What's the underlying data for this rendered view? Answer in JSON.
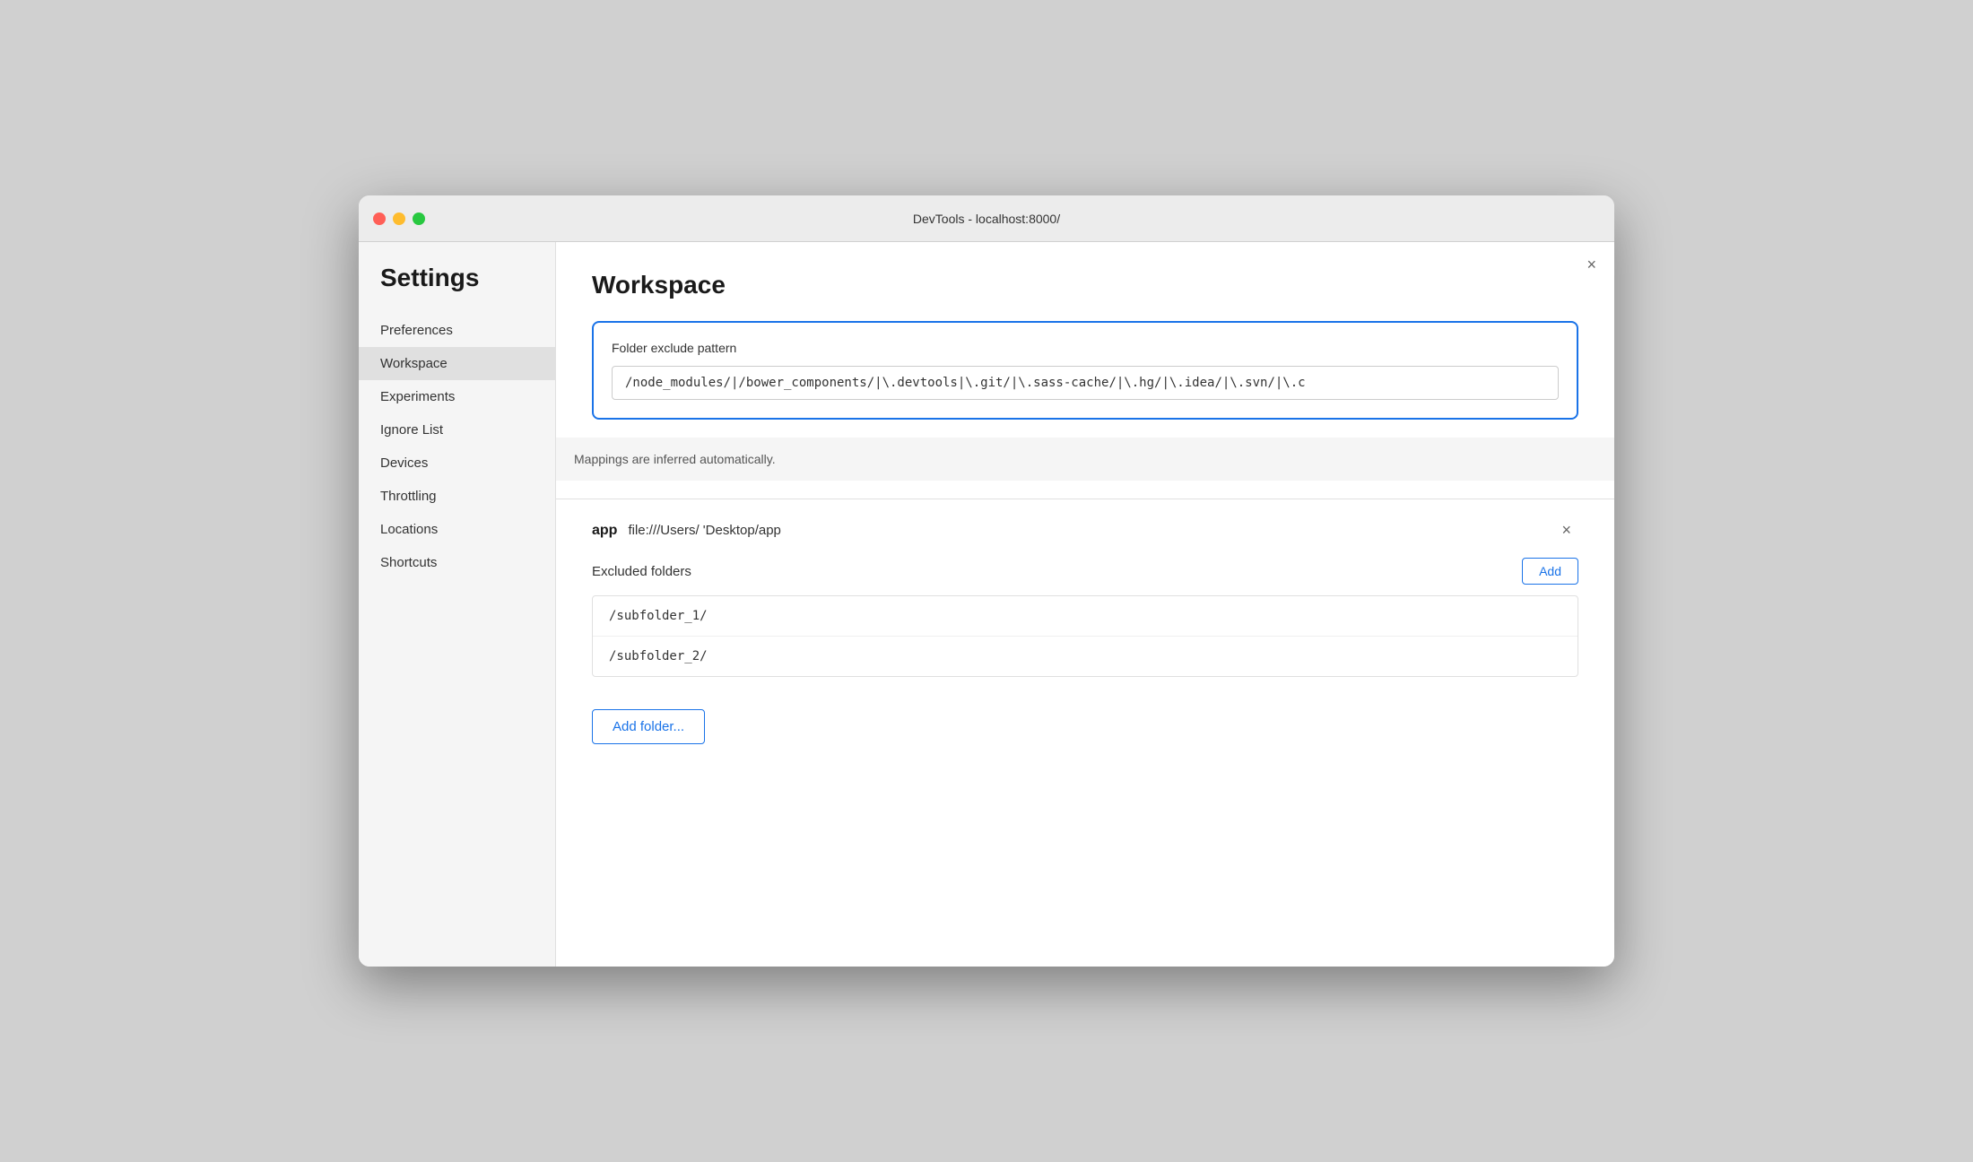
{
  "window": {
    "title": "DevTools - localhost:8000/"
  },
  "sidebar": {
    "heading": "Settings",
    "items": [
      {
        "id": "preferences",
        "label": "Preferences",
        "active": false
      },
      {
        "id": "workspace",
        "label": "Workspace",
        "active": true
      },
      {
        "id": "experiments",
        "label": "Experiments",
        "active": false
      },
      {
        "id": "ignore-list",
        "label": "Ignore List",
        "active": false
      },
      {
        "id": "devices",
        "label": "Devices",
        "active": false
      },
      {
        "id": "throttling",
        "label": "Throttling",
        "active": false
      },
      {
        "id": "locations",
        "label": "Locations",
        "active": false
      },
      {
        "id": "shortcuts",
        "label": "Shortcuts",
        "active": false
      }
    ]
  },
  "main": {
    "page_title": "Workspace",
    "close_button": "×",
    "folder_exclude": {
      "label": "Folder exclude pattern",
      "value": "/node_modules/|/bower_components/|\\.devtools|\\.git/|\\.sass-cache/|\\.hg/|\\.idea/|\\.svn/|\\.c"
    },
    "mappings_info": "Mappings are inferred automatically.",
    "workspace_entry": {
      "name": "app",
      "path": "file:///Users/      'Desktop/app",
      "remove_button": "×"
    },
    "excluded_folders": {
      "label": "Excluded folders",
      "add_button": "Add",
      "items": [
        "/subfolder_1/",
        "/subfolder_2/"
      ]
    },
    "add_folder_button": "Add folder..."
  }
}
